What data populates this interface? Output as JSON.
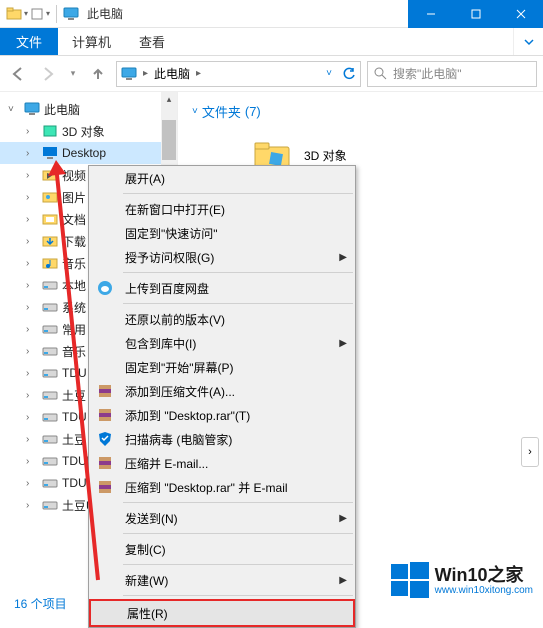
{
  "window": {
    "title": "此电脑"
  },
  "ribbon": {
    "file": "文件",
    "tabs": [
      "计算机",
      "查看"
    ]
  },
  "address": {
    "location": "此电脑",
    "search_placeholder": "搜索\"此电脑\""
  },
  "tree": {
    "root": "此电脑",
    "items": [
      {
        "label": "3D 对象",
        "icon": "cube"
      },
      {
        "label": "Desktop",
        "icon": "desktop",
        "selected": true
      },
      {
        "label": "视频",
        "icon": "video"
      },
      {
        "label": "图片",
        "icon": "pictures"
      },
      {
        "label": "文档",
        "icon": "documents"
      },
      {
        "label": "下载",
        "icon": "downloads"
      },
      {
        "label": "音乐",
        "icon": "music"
      },
      {
        "label": "本地",
        "icon": "drive"
      },
      {
        "label": "系统",
        "icon": "drive"
      },
      {
        "label": "常用",
        "icon": "drive"
      },
      {
        "label": "音乐",
        "icon": "drive"
      },
      {
        "label": "TDU",
        "icon": "drive"
      },
      {
        "label": "土豆",
        "icon": "drive"
      },
      {
        "label": "TDU",
        "icon": "drive"
      },
      {
        "label": "土豆",
        "icon": "drive"
      },
      {
        "label": "TDUP",
        "icon": "drive"
      },
      {
        "label": "TDUP",
        "icon": "drive"
      },
      {
        "label": "土豆U",
        "icon": "drive"
      }
    ]
  },
  "content": {
    "section_label": "文件夹",
    "section_count": "(7)",
    "first_item": "3D 对象"
  },
  "context_menu": [
    {
      "label": "展开(A)"
    },
    {
      "divider": true
    },
    {
      "label": "在新窗口中打开(E)"
    },
    {
      "label": "固定到\"快速访问\""
    },
    {
      "label": "授予访问权限(G)",
      "submenu": true
    },
    {
      "divider": true
    },
    {
      "label": "上传到百度网盘",
      "icon": "baidu"
    },
    {
      "divider": true
    },
    {
      "label": "还原以前的版本(V)"
    },
    {
      "label": "包含到库中(I)",
      "submenu": true
    },
    {
      "label": "固定到\"开始\"屏幕(P)"
    },
    {
      "label": "添加到压缩文件(A)...",
      "icon": "rar"
    },
    {
      "label": "添加到 \"Desktop.rar\"(T)",
      "icon": "rar"
    },
    {
      "label": "扫描病毒 (电脑管家)",
      "icon": "shield"
    },
    {
      "label": "压缩并 E-mail...",
      "icon": "rar"
    },
    {
      "label": "压缩到 \"Desktop.rar\" 并 E-mail",
      "icon": "rar"
    },
    {
      "divider": true
    },
    {
      "label": "发送到(N)",
      "submenu": true
    },
    {
      "divider": true
    },
    {
      "label": "复制(C)"
    },
    {
      "divider": true
    },
    {
      "label": "新建(W)",
      "submenu": true
    },
    {
      "divider": true
    },
    {
      "label": "属性(R)",
      "highlight": true
    }
  ],
  "status": {
    "count_label": "16 个项目"
  },
  "watermark": {
    "brand": "Win10之家",
    "url": "www.win10xitong.com"
  }
}
